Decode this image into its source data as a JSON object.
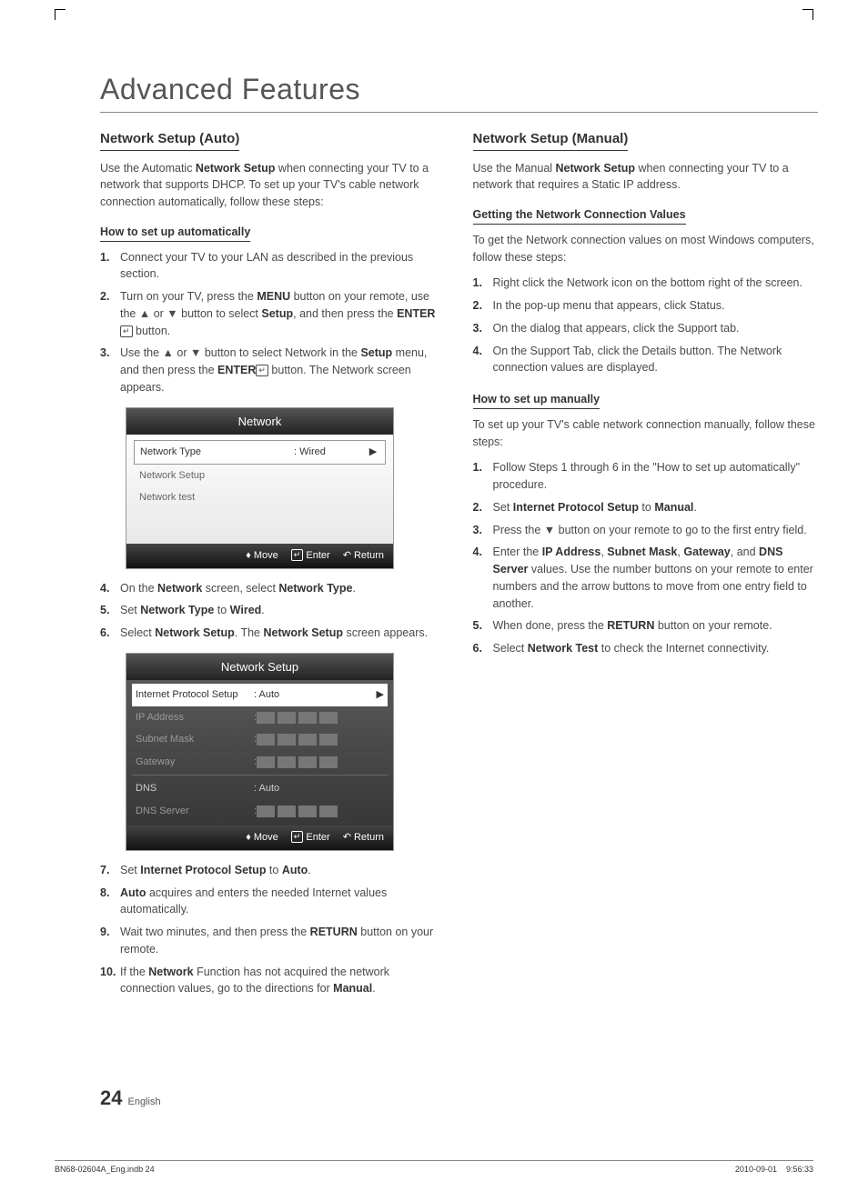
{
  "page": {
    "title": "Advanced Features",
    "pageNumber": "24",
    "pageLang": "English",
    "footerLeft": "BN68-02604A_Eng.indb   24",
    "footerRight": "2010-09-01      9:56:33"
  },
  "left": {
    "heading": "Network Setup (Auto)",
    "intro_pre": "Use the Automatic ",
    "intro_bold": "Network Setup",
    "intro_post": " when connecting your TV to a network that supports DHCP. To set up your TV's cable network connection automatically, follow these steps:",
    "sub1": "How to set up automatically",
    "steps1": [
      {
        "n": "1.",
        "t": "Connect your TV to your LAN as described in the previous section."
      },
      {
        "n": "2.",
        "pre": "Turn on your TV, press the ",
        "b1": "MENU",
        "mid": " button on your remote, use the ▲ or ▼ button to select ",
        "b2": "Setup",
        "mid2": ", and then press the ",
        "b3": "ENTER",
        "post": " button.",
        "enter": true
      },
      {
        "n": "3.",
        "pre": "Use the ▲ or ▼ button to select Network in the ",
        "b1": "Setup",
        "mid": " menu, and then press the ",
        "b2": "ENTER",
        "post": " button. The Network screen appears.",
        "enter": true
      }
    ],
    "steps2": [
      {
        "n": "4.",
        "pre": "On the ",
        "b1": "Network",
        "mid": " screen, select ",
        "b2": "Network Type",
        "post": "."
      },
      {
        "n": "5.",
        "pre": "Set ",
        "b1": "Network Type",
        "mid": " to ",
        "b2": "Wired",
        "post": "."
      },
      {
        "n": "6.",
        "pre": "Select ",
        "b1": "Network Setup",
        "mid": ". The ",
        "b2": "Network Setup",
        "post": " screen appears."
      }
    ],
    "steps3": [
      {
        "n": "7.",
        "pre": "Set ",
        "b1": "Internet Protocol Setup",
        "mid": " to ",
        "b2": "Auto",
        "post": "."
      },
      {
        "n": "8.",
        "b1": "Auto",
        "post": " acquires and enters the needed Internet values automatically."
      },
      {
        "n": "9.",
        "pre": "Wait two minutes, and then press the ",
        "b1": "RETURN",
        "post": " button on your remote."
      },
      {
        "n": "10.",
        "pre": "If the ",
        "b1": "Network",
        "mid": " Function has not acquired the network connection values, go to the directions for ",
        "b2": "Manual",
        "post": "."
      }
    ]
  },
  "right": {
    "heading": "Network Setup (Manual)",
    "intro_pre": "Use the Manual ",
    "intro_bold": "Network Setup",
    "intro_post": " when connecting your TV to a network that requires a Static IP address.",
    "sub1": "Getting the Network Connection Values",
    "para1": "To get the Network connection values on most Windows computers, follow these steps:",
    "stepsA": [
      {
        "n": "1.",
        "t": "Right click the Network icon on the bottom right of the screen."
      },
      {
        "n": "2.",
        "t": "In the pop-up menu that appears, click Status."
      },
      {
        "n": "3.",
        "t": "On the dialog that appears, click the Support tab."
      },
      {
        "n": "4.",
        "t": "On the Support Tab, click the Details button. The Network connection values are displayed."
      }
    ],
    "sub2": "How to set up manually",
    "para2": "To set up your TV's cable network connection manually, follow these steps:",
    "stepsB": [
      {
        "n": "1.",
        "t": "Follow Steps 1 through 6 in the \"How to set up automatically\" procedure."
      },
      {
        "n": "2.",
        "pre": "Set ",
        "b1": "Internet Protocol Setup",
        "mid": " to ",
        "b2": "Manual",
        "post": "."
      },
      {
        "n": "3.",
        "t": "Press the ▼ button on your remote to go to the first entry field."
      },
      {
        "n": "4.",
        "pre": "Enter the ",
        "b1": "IP Address",
        "c1": ", ",
        "b2": "Subnet Mask",
        "c2": ", ",
        "b3": "Gateway",
        "c3": ", and ",
        "b4": "DNS Server",
        "post": " values. Use the number buttons on your remote to enter numbers and the arrow buttons to move from one entry field to another."
      },
      {
        "n": "5.",
        "pre": "When done, press the ",
        "b1": "RETURN",
        "post": " button on your remote."
      },
      {
        "n": "6.",
        "pre": "Select ",
        "b1": "Network Test",
        "post": " to check the Internet connectivity."
      }
    ]
  },
  "ui1": {
    "title": "Network",
    "rows": [
      {
        "label": "Network Type",
        "value": ": Wired",
        "selected": true,
        "arrow": "▶"
      },
      {
        "label": "Network Setup",
        "value": ""
      },
      {
        "label": "Network test",
        "value": ""
      }
    ],
    "footer": {
      "move": "Move",
      "enter": "Enter",
      "ret": "Return"
    }
  },
  "ui2": {
    "title": "Network Setup",
    "rows": [
      {
        "label": "Internet Protocol Setup",
        "value": ": Auto",
        "sel": true,
        "arrow": "▶"
      },
      {
        "label": "IP Address",
        "fields": true,
        "faded": true
      },
      {
        "label": "Subnet Mask",
        "fields": true,
        "faded": true
      },
      {
        "label": "Gateway",
        "fields": true,
        "faded": true
      },
      {
        "sep": true
      },
      {
        "label": "DNS",
        "value": ": Auto"
      },
      {
        "label": "DNS Server",
        "fields": true,
        "faded": true
      }
    ],
    "footer": {
      "move": "Move",
      "enter": "Enter",
      "ret": "Return"
    }
  }
}
